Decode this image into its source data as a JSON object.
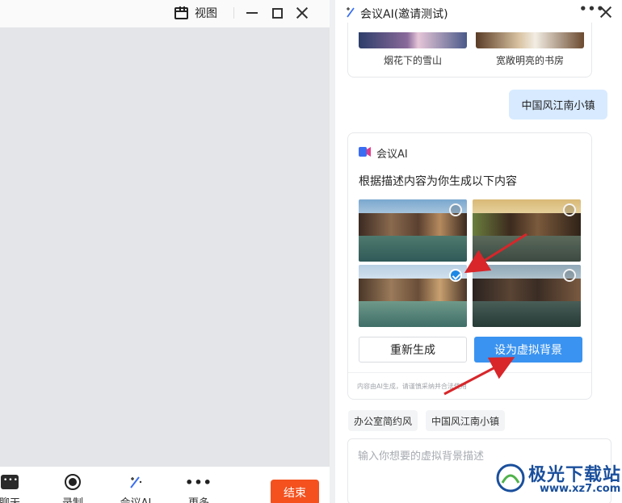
{
  "left_window": {
    "view_label": "视图",
    "toolbar": {
      "chat_label": "聊天",
      "record_label": "录制",
      "ai_label": "会议AI",
      "more_label": "更多",
      "end_label": "结束"
    }
  },
  "ai_panel": {
    "title": "会议AI(邀请测试)",
    "previous_results": [
      {
        "caption": "烟花下的雪山"
      },
      {
        "caption": "宽敞明亮的书房"
      }
    ],
    "user_message": "中国风江南小镇",
    "response": {
      "brand": "会议AI",
      "description": "根据描述内容为你生成以下内容",
      "images": [
        {
          "selected": false
        },
        {
          "selected": false
        },
        {
          "selected": true
        },
        {
          "selected": false
        }
      ],
      "regenerate_label": "重新生成",
      "set_background_label": "设为虚拟背景",
      "disclaimer": "内容由AI生成，请谨慎采纳并合法使用"
    },
    "suggestions": [
      "办公室简约风",
      "中国风江南小镇"
    ],
    "prompt_placeholder": "输入你想要的虚拟背景描述"
  },
  "watermark": {
    "name": "极光下载站",
    "url": "www.xz7.com"
  },
  "colors": {
    "accent_blue": "#3a93f0",
    "end_red": "#f4511e",
    "user_bubble": "#d7eaff",
    "annotation_red": "#d8262a"
  }
}
